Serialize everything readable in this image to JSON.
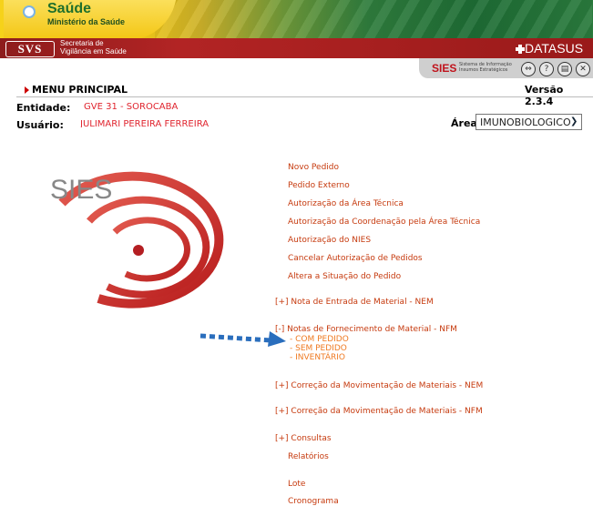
{
  "header": {
    "saude_title": "Saúde",
    "saude_subtitle": "Ministério da Saúde",
    "svs_logo": "SVS",
    "svs_line1": "Secretaria de",
    "svs_line2": "Vigilância em Saúde",
    "datasus": "DATASUS",
    "sies_small": "SIES",
    "sies_small_sub1": "Sistema de Informação",
    "sies_small_sub2": "Insumos Estratégicos",
    "toolbar_icons": [
      "back-icon",
      "help-icon",
      "print-icon",
      "close-icon"
    ]
  },
  "nav": {
    "menu_principal": "MENU PRINCIPAL",
    "versao": "Versão 2.3.4"
  },
  "info": {
    "entidade_label": "Entidade:",
    "entidade_value": "GVE 31 - SOROCABA",
    "usuario_label": "Usuário:",
    "usuario_value": "JULIMARI PEREIRA FERREIRA",
    "area_label": "Área:",
    "area_value": "IMUNOBIOLOGICO"
  },
  "logo": {
    "text": "SIES"
  },
  "menu": {
    "items_pedido": [
      "Novo Pedido",
      "Pedido Externo",
      "Autorização da Área Técnica",
      "Autorização da Coordenação pela Área Técnica",
      "Autorização do NIES",
      "Cancelar Autorização de Pedidos",
      "Altera a Situação do Pedido"
    ],
    "nem": "[+] Nota de Entrada de Material - NEM",
    "nfm": "[-] Notas de Fornecimento de Material - NFM",
    "nfm_sub": [
      "- COM PEDIDO",
      "- SEM PEDIDO",
      "- INVENTÁRIO"
    ],
    "correcao_nem": "[+] Correção da Movimentação de Materiais - NEM",
    "correcao_nfm": "[+] Correção da Movimentação de Materiais - NFM",
    "consultas": "[+] Consultas",
    "relatorios": "Relatórios",
    "lote": "Lote",
    "cronograma": "Cronograma"
  },
  "colors": {
    "link": "#c63a0e",
    "sublink": "#ef7a22",
    "value_red": "#e0242e",
    "arrow_blue": "#2a6ebd"
  }
}
